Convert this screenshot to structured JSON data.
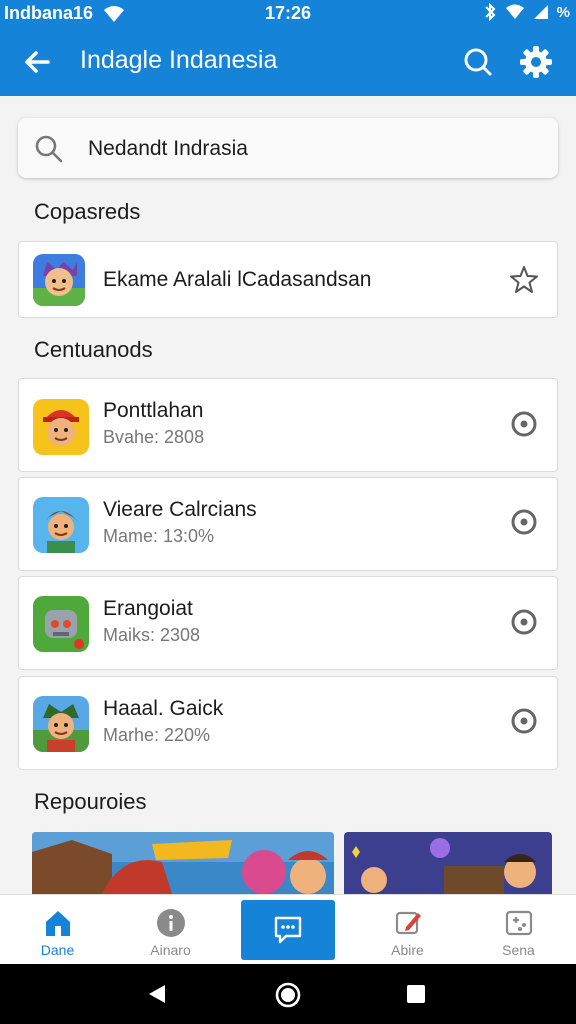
{
  "status_bar": {
    "left_text": "Indbana16",
    "time": "17:26",
    "battery_text": "%"
  },
  "app_bar": {
    "title": "Indagle Indanesia"
  },
  "search": {
    "value": "Nedandt Indrasia"
  },
  "sections": {
    "featured_title": "Copasreds",
    "list_title": "Centuanods",
    "bottom_title": "Repouroies"
  },
  "featured_item": {
    "name": "Ekame Aralali lCadasandsan",
    "icon": "star-outline-icon"
  },
  "list_items": [
    {
      "name": "Ponttlahan",
      "sub": "Bvahe: 2808",
      "icon": "radio-circle-icon"
    },
    {
      "name": "Vieare Calrcians",
      "sub": "Mame: 13:0%",
      "icon": "radio-circle-icon"
    },
    {
      "name": "Erangoiat",
      "sub": "Maiks: 2308",
      "icon": "radio-circle-icon"
    },
    {
      "name": "Haaal. Gaick",
      "sub": "Marhe: 220%",
      "icon": "radio-circle-icon"
    }
  ],
  "bottom_nav": [
    {
      "label": "Dane",
      "icon": "home-icon",
      "active": true
    },
    {
      "label": "Ainaro",
      "icon": "info-circle-icon",
      "active": false
    },
    {
      "label": "",
      "icon": "chat-icon",
      "active": false
    },
    {
      "label": "Abire",
      "icon": "edit-icon",
      "active": false
    },
    {
      "label": "Sena",
      "icon": "gamepad-icon",
      "active": false
    }
  ],
  "colors": {
    "primary": "#1483d8",
    "background": "#f3f3f3",
    "card": "#ffffff"
  }
}
